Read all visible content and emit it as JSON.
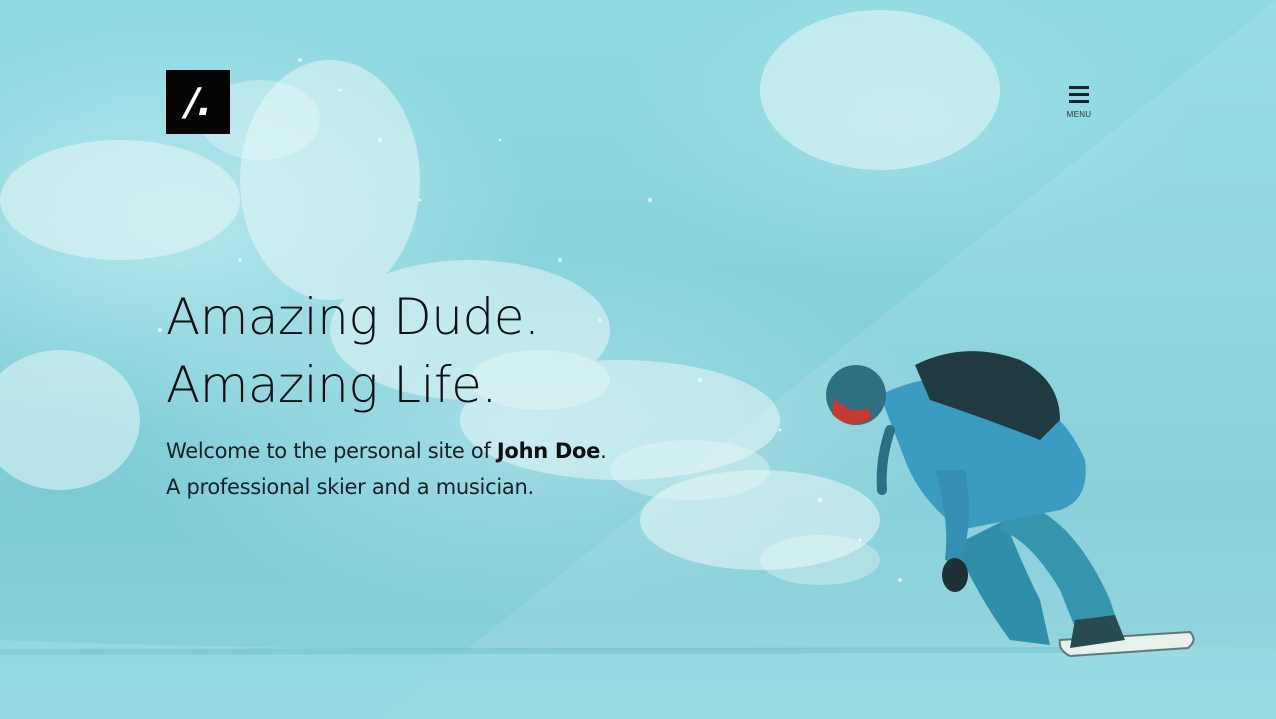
{
  "brand": {
    "logo_text": "/.",
    "logo_bg": "#050505",
    "logo_fg": "#ffffff"
  },
  "menu": {
    "icon": "hamburger-menu-icon",
    "label": "MENU"
  },
  "hero": {
    "headline_line1": "Amazing Dude.",
    "headline_line2": "Amazing Life.",
    "intro_prefix": "Welcome to the personal site of ",
    "intro_name": "John Doe",
    "intro_suffix": ".",
    "intro_line2": "A professional skier and a musician.",
    "background_image": "snowboarder carving through powder snow",
    "tint_color": "#86d2dc"
  }
}
